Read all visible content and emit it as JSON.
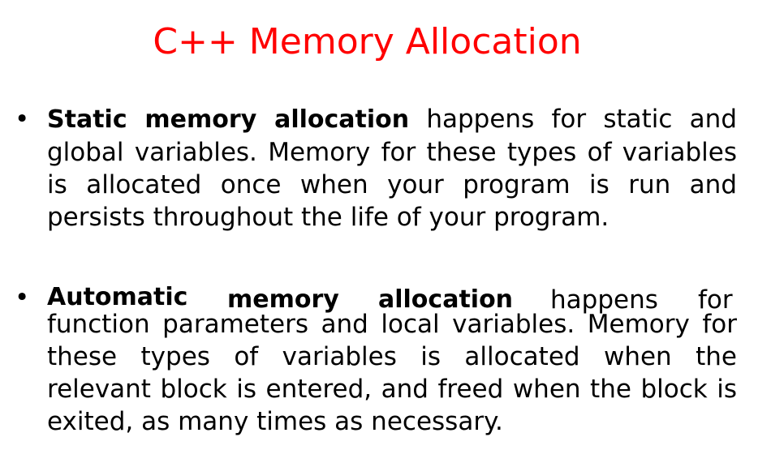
{
  "slide": {
    "title": "C++ Memory Allocation",
    "bullets": [
      {
        "marker": "•",
        "lead": "Static memory allocation",
        "text": "happens for static and global variables. Memory for these types of variables is allocated once when your program is run and persists throughout the life of your program."
      },
      {
        "marker": "•",
        "lead_word1": "Automatic",
        "lead_word2": "memory",
        "lead_word3": "allocation",
        "word_happens": "happens",
        "word_for": "for",
        "text": "function parameters and local variables. Memory for these types of variables is allocated when the relevant block is entered, and freed when the block is exited, as many times as necessary."
      }
    ]
  },
  "colors": {
    "title": "#ff0000",
    "body": "#000000",
    "background": "#ffffff"
  }
}
